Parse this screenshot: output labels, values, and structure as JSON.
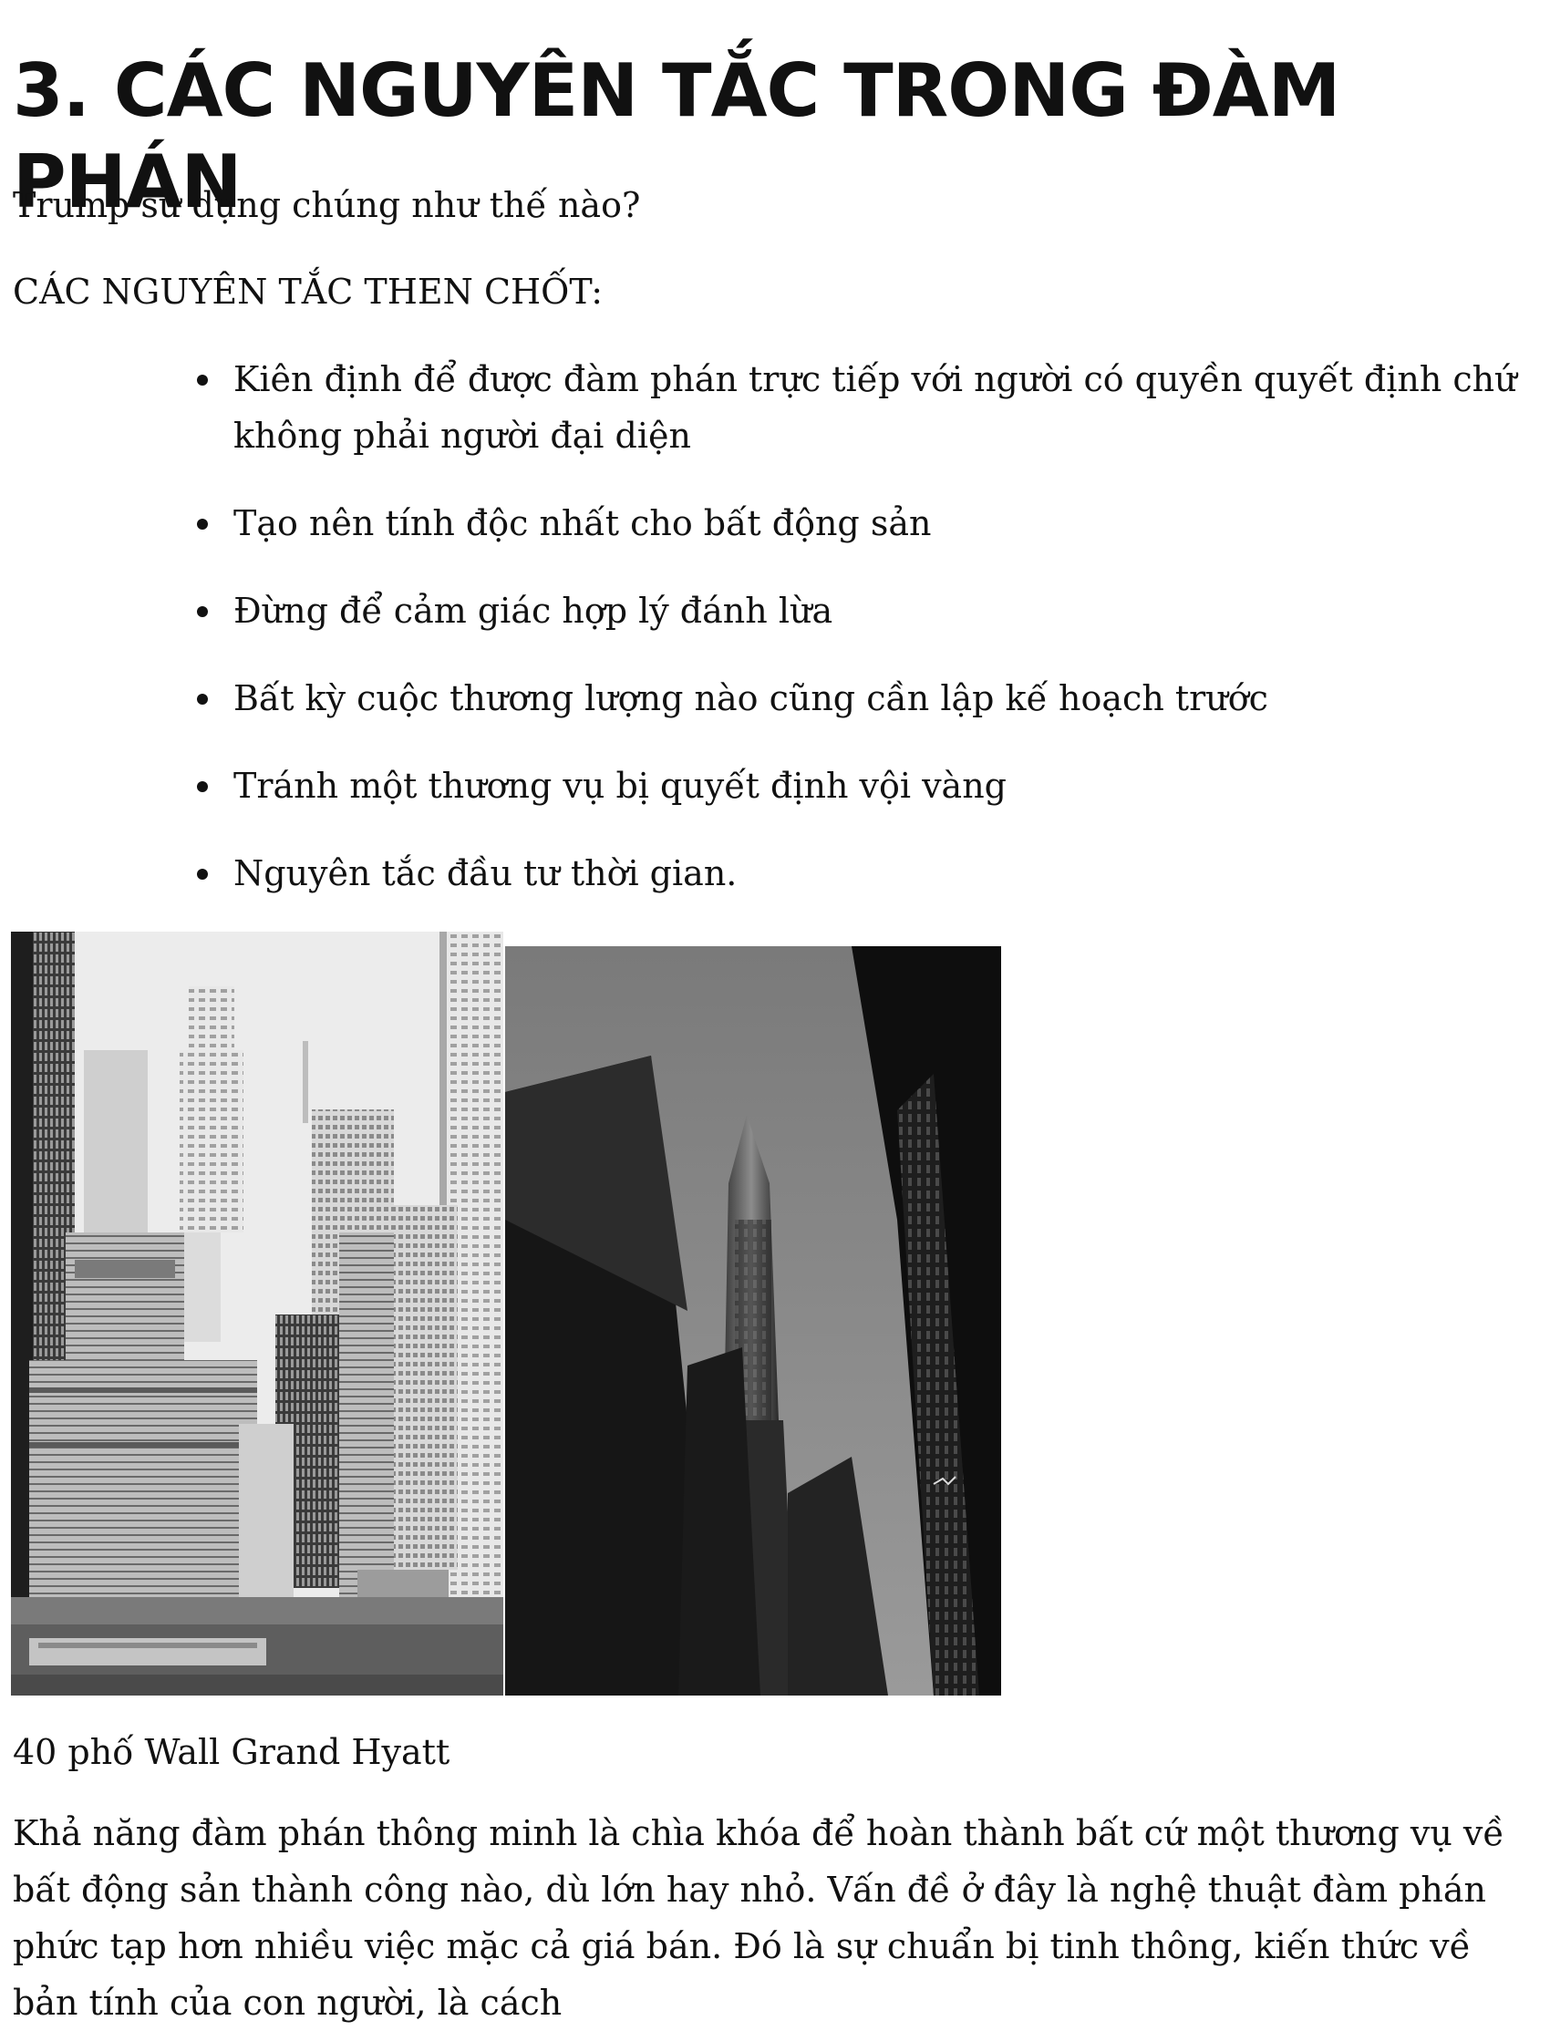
{
  "heading": "3. CÁC NGUYÊN TẮC TRONG ĐÀM PHÁN",
  "subtitle": "Trump sử dụng chúng như thế nào?",
  "section_label": "CÁC NGUYÊN TẮC THEN CHỐT:",
  "principles": [
    "Kiên định để được đàm phán trực tiếp với người có quyền quyết định chứ không phải người đại diện",
    "Tạo nên tính độc nhất cho bất động sản",
    "Đừng để cảm giác hợp lý đánh lừa",
    "Bất kỳ cuộc thương lượng nào cũng cần lập kế hoạch trước",
    "Tránh một thương vụ bị quyết định vội vàng",
    "Nguyên tắc đầu tư thời gian."
  ],
  "photos": {
    "left_subject": "skyline-photo",
    "right_subject": "skyscraper-photo"
  },
  "caption": "40 phố Wall Grand Hyatt",
  "body_text": "Khả năng đàm phán thông minh là chìa khóa để hoàn thành bất cứ một thương vụ về bất động sản thành công nào, dù lớn hay nhỏ. Vấn đề ở đây là nghệ thuật đàm phán phức tạp hơn nhiều việc mặc cả giá bán. Đó là sự chuẩn bị tinh thông, kiến thức về bản tính của con người, là cách"
}
